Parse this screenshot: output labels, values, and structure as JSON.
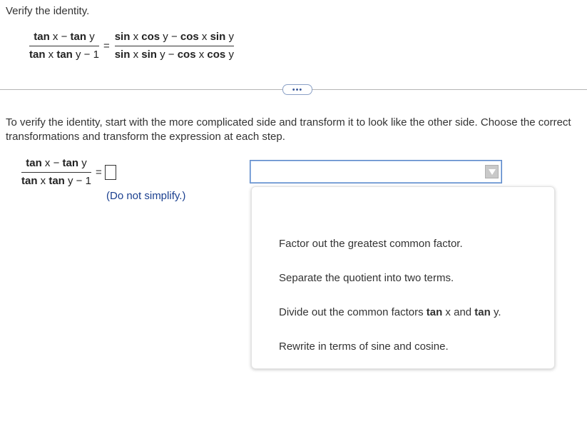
{
  "problem": {
    "title": "Verify the identity.",
    "identity": {
      "lhs_numerator": [
        "tan",
        " x",
        " − ",
        "tan",
        " y"
      ],
      "lhs_denominator": [
        "tan",
        " x ",
        "tan",
        " y",
        " − 1"
      ],
      "equals": "=",
      "rhs_numerator": [
        "sin",
        " x ",
        "cos",
        " y",
        " − ",
        "cos",
        " x ",
        "sin",
        " y"
      ],
      "rhs_denominator": [
        "sin",
        " x ",
        "sin",
        " y",
        " − ",
        "cos",
        " x ",
        "cos",
        " y"
      ]
    }
  },
  "more_button": {
    "label": "•••"
  },
  "instructions": "To verify the identity, start with the more complicated side and transform it to look like the other side. Choose the correct transformations and transform the expression at each step.",
  "step": {
    "equals": "=",
    "answer_value": "",
    "hint": "(Do not simplify.)"
  },
  "transformation_select": {
    "selected": "",
    "options": [
      "Factor out the greatest common factor.",
      "Separate the quotient into two terms.",
      [
        "Divide out the common factors ",
        "tan",
        " x and ",
        "tan",
        " y."
      ],
      "Rewrite in terms of sine and cosine."
    ]
  },
  "colors": {
    "text": "#333333",
    "hint_blue": "#1a3f8f",
    "select_border": "#5b86c7",
    "divider": "#b5b5b5"
  }
}
